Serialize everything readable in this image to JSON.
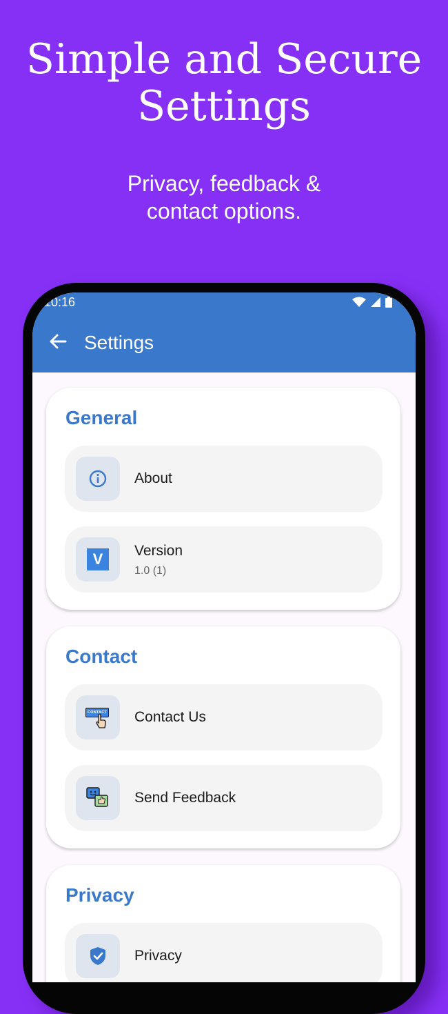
{
  "promo": {
    "headline_line1": "Simple and Secure",
    "headline_line2": "Settings",
    "subline_line1": "Privacy, feedback &",
    "subline_line2": "contact options."
  },
  "status_bar": {
    "time": "10:16"
  },
  "app_bar": {
    "title": "Settings"
  },
  "sections": {
    "general": {
      "title": "General",
      "about": {
        "label": "About"
      },
      "version": {
        "label": "Version",
        "value": "1.0 (1)",
        "badge": "V"
      }
    },
    "contact": {
      "title": "Contact",
      "contact_us": {
        "label": "Contact Us",
        "icon_text": "CONTACT"
      },
      "send_feedback": {
        "label": "Send Feedback"
      }
    },
    "privacy": {
      "title": "Privacy",
      "privacy_item": {
        "label": "Privacy"
      }
    }
  },
  "colors": {
    "background": "#8630f5",
    "app_bar": "#3a78cc",
    "section_title": "#3a78cc",
    "item_background": "#f4f4f4",
    "icon_box": "#dfe5ee"
  }
}
